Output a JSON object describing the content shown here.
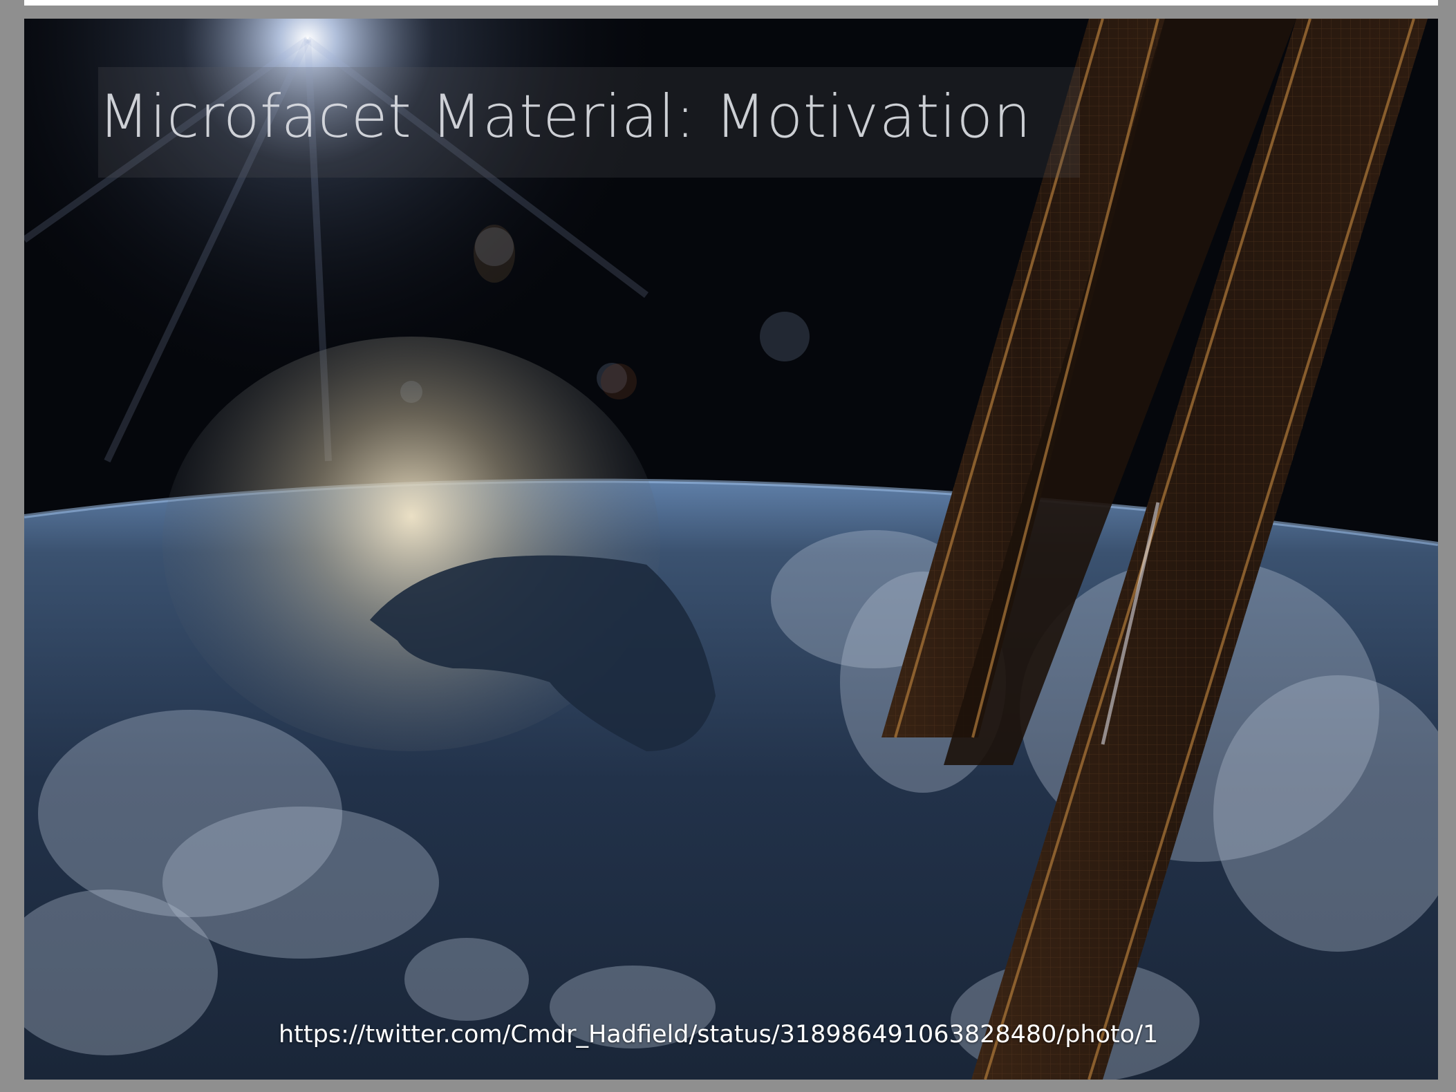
{
  "slide": {
    "title": "Microfacet Material: Motivation",
    "image_credit": "https://twitter.com/Cmdr_Hadfield/status/318986491063828480/photo/1"
  },
  "colors": {
    "frame": "#8f8f8f",
    "space": "#05070c",
    "ocean": "#2a3a52",
    "sun_glint": "#e8dcc0",
    "solar_panel": "#2a1a10",
    "panel_trim": "#b07a3a"
  }
}
